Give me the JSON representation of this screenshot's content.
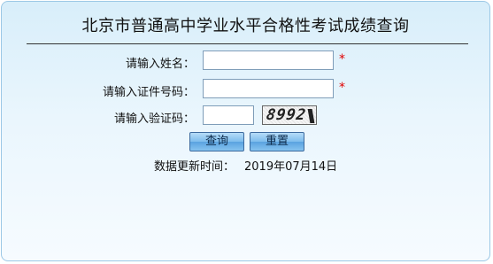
{
  "title": "北京市普通高中学业水平合格性考试成绩查询",
  "form": {
    "name_label": "请输入姓名：",
    "name_value": "",
    "id_label": "请输入证件号码：",
    "id_value": "",
    "captcha_label": "请输入验证码：",
    "captcha_value": "",
    "captcha_image_text": "8992",
    "required_mark": "*"
  },
  "buttons": {
    "query": "查询",
    "reset": "重置"
  },
  "update": {
    "label": "数据更新时间：",
    "date": "2019年07月14日"
  },
  "colors": {
    "required": "#e00000",
    "panel_border": "#9cc8e6",
    "button_blue": "#7dbcec"
  }
}
